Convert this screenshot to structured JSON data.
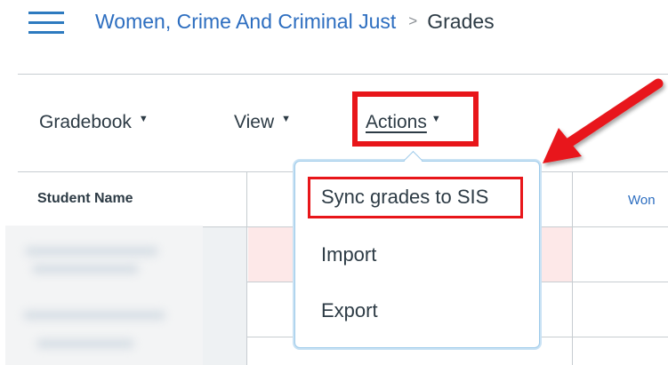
{
  "header": {
    "course_name": "Women, Crime And Criminal Just",
    "separator": ">",
    "current_page": "Grades"
  },
  "toolbar": {
    "gradebook_label": "Gradebook",
    "view_label": "View",
    "actions_label": "Actions",
    "caret": "▼"
  },
  "grid": {
    "student_name_header": "Student Name",
    "assignment_header_partial": "Won"
  },
  "actions_menu": {
    "items": [
      "Sync grades to SIS",
      "Import",
      "Export"
    ]
  },
  "colors": {
    "link_blue": "#2d6ec0",
    "text_dark": "#2d3b45",
    "annotation_red": "#e8161a",
    "invalid_cell_pink": "#fde8e8"
  },
  "icons": {
    "menu": "hamburger-icon",
    "breadcrumb_separator": "chevron-right-icon",
    "dropdown_caret": "caret-down-icon",
    "annotation": "red-arrow-annotation"
  }
}
